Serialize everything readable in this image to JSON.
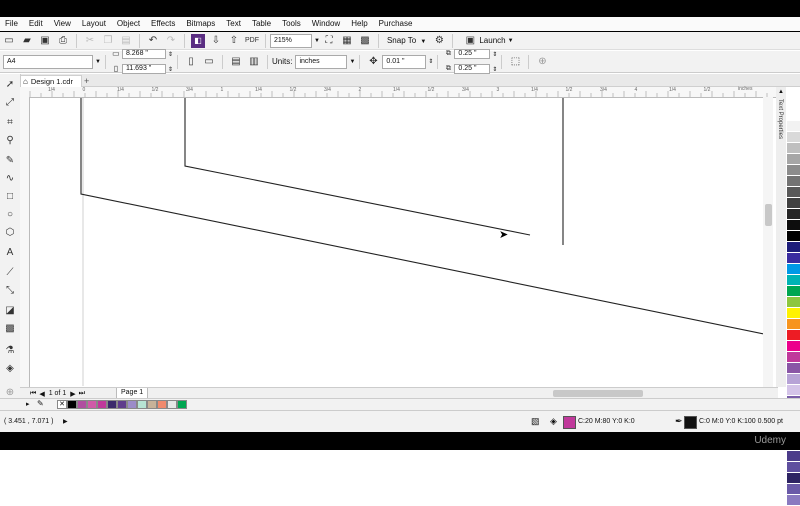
{
  "menubar": {
    "items": [
      "File",
      "Edit",
      "View",
      "Layout",
      "Object",
      "Effects",
      "Bitmaps",
      "Text",
      "Table",
      "Tools",
      "Window",
      "Help",
      "Purchase"
    ]
  },
  "toolbar1": {
    "zoom": "215%",
    "snap_label": "Snap To",
    "launch_label": "Launch"
  },
  "toolbar2": {
    "page_size": "A4",
    "width": "8.268 \"",
    "height": "11.693 \"",
    "units_label": "Units:",
    "units_value": "inches",
    "nudge": "0.01 \"",
    "dup_x": "0.25 \"",
    "dup_y": "0.25 \""
  },
  "doc_tab": {
    "title": "Design 1.cdr"
  },
  "ruler": {
    "top_labels": [
      "1/4",
      "0",
      "1/4",
      "1/2",
      "3/4",
      "1",
      "1/4",
      "1/2",
      "3/4",
      "2",
      "1/4",
      "1/2",
      "3/4",
      "3",
      "1/4",
      "1/2",
      "3/4",
      "4",
      "1/4",
      "1/2"
    ],
    "unit": "inches"
  },
  "page_nav": {
    "counter": "1 of 1",
    "page_tab": "Page 1"
  },
  "panel": {
    "text_properties": "Text Properties"
  },
  "status": {
    "coords": "( 3.451 , 7.071 )",
    "fill_info": "C:20 M:80 Y:0 K:0",
    "outline_info": "C:0 M:0 Y:0 K:100  0.500 pt"
  },
  "colors": {
    "fill": "#c0399b",
    "outline": "#111111",
    "palette": [
      "#ffffff",
      "#f2f2f2",
      "#d9d9d9",
      "#bfbfbf",
      "#a6a6a6",
      "#8c8c8c",
      "#737373",
      "#595959",
      "#404040",
      "#262626",
      "#0d0d0d",
      "#000000",
      "#1d1d7a",
      "#3a2ca0",
      "#0099e6",
      "#00b3b3",
      "#00a651",
      "#8dc63f",
      "#fff200",
      "#f7941d",
      "#ed1c24",
      "#ec008c",
      "#c0399b",
      "#8a56a6",
      "#b7a3d6",
      "#d4c4e8",
      "#7a5ea8",
      "#5b3c8c",
      "#6f5aa0",
      "#9c8cc9",
      "#3b2a6b",
      "#4c3c8a",
      "#5f4f9f",
      "#2e2463",
      "#6a5aa8",
      "#8a7ac0"
    ],
    "doc_palette": [
      "#000000",
      "#b04ea0",
      "#d05aa8",
      "#c0399b",
      "#3b2a6b",
      "#5f3c8c",
      "#9c8cc9",
      "#b7e4d4",
      "#c7b299",
      "#f08a6e",
      "#e6e6e6",
      "#00a651"
    ]
  },
  "watermark": {
    "brand": "Udemy"
  }
}
